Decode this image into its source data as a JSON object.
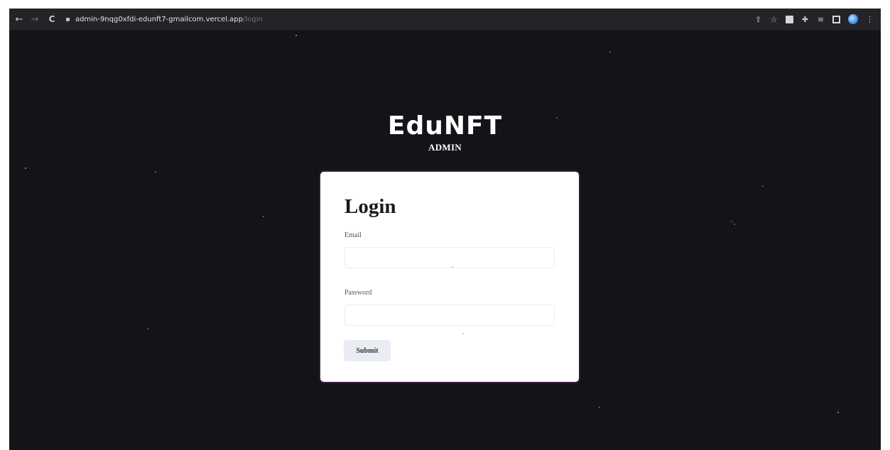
{
  "browser": {
    "url_host": "admin-9nqg0xfdi-edunft7-gmailcom.vercel.app",
    "url_path": "/login",
    "nav_back": "←",
    "nav_forward": "→",
    "nav_reload": "C",
    "icons": [
      "share-icon",
      "bookmark-star-icon",
      "extension-icon",
      "extension-pin-icon",
      "reading-list-icon",
      "side-panel-icon",
      "profile-avatar-icon",
      "menu-kebab-icon"
    ]
  },
  "brand": {
    "title": "EduNFT",
    "subtitle": "ADMIN"
  },
  "login": {
    "heading": "Login",
    "email_label": "Email",
    "email_value": "",
    "password_label": "Password",
    "password_value": "",
    "submit_label": "Submit"
  },
  "colors": {
    "background": "#141317",
    "card": "#ffffff",
    "button": "#e9ecf3"
  }
}
